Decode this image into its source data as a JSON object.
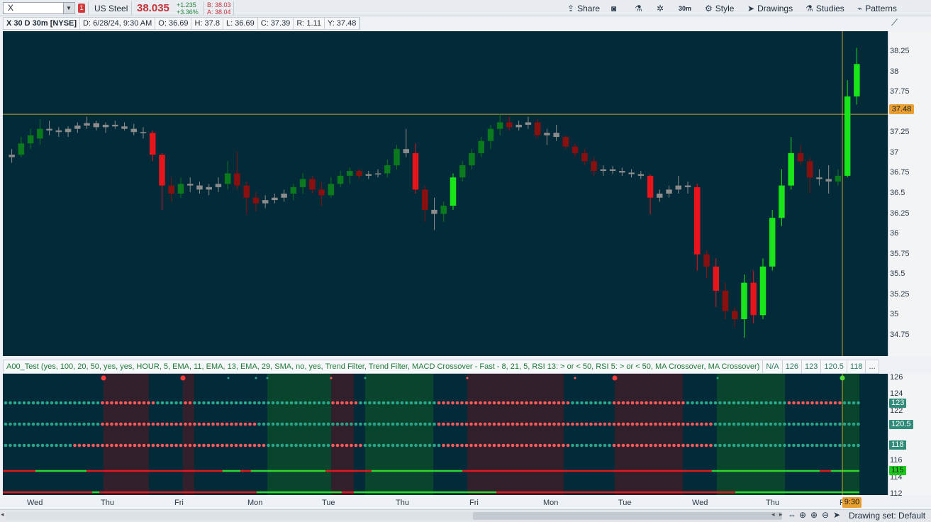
{
  "toolbar": {
    "symbol": "X",
    "alert_count": "1",
    "company": "US Steel",
    "last": "38.035",
    "net_change": "+1.235",
    "pct_change": "+3.36%",
    "bid": "B: 38.03",
    "ask": "A: 38.04",
    "share": "Share",
    "aggregation": "30m",
    "style": "Style",
    "drawings": "Drawings",
    "studies": "Studies",
    "patterns": "Patterns"
  },
  "infobar": {
    "desc": "X 30 D 30m [NYSE]",
    "date": "D: 6/28/24, 9:30 AM",
    "open": "O: 36.69",
    "high": "H: 37.8",
    "low": "L: 36.69",
    "close": "C: 37.39",
    "range": "R: 1.11",
    "y": "Y: 37.48"
  },
  "price_axis": {
    "ticks": [
      "38.25",
      "38",
      "37.75",
      "37.5",
      "37.25",
      "37",
      "36.75",
      "36.5",
      "36.25",
      "36",
      "35.75",
      "35.5",
      "35.25",
      "35",
      "34.75"
    ],
    "cursor_price": "37.48"
  },
  "study": {
    "title": "A00_Test (yes, 100, 20, 50, yes, yes, HOUR, 5, EMA, 11, EMA, 13, EMA, 29, SMA, no, yes, Trend Filter, Trend Filter, MACD Crossover - Fast - 8, 21, 5, RSI 13: > or < 50, RSI 5: > or < 50, MA Crossover, MA Crossover)",
    "values": [
      "N/A",
      "126",
      "123",
      "120.5",
      "118"
    ],
    "more": "...",
    "axis_ticks": [
      "126",
      "124",
      "122",
      "120",
      "118",
      "116",
      "114",
      "112"
    ],
    "level_tags": [
      "123",
      "120.5",
      "118",
      "115"
    ]
  },
  "time_axis": {
    "days": [
      "Wed",
      "Thu",
      "Fri",
      "Mon",
      "Tue",
      "Thu",
      "Fri",
      "Mon",
      "Tue",
      "Wed",
      "Thu",
      "F"
    ],
    "cursor_time": "9:30"
  },
  "bottombar": {
    "drawing_set": "Drawing set: Default"
  },
  "colors": {
    "chart_bg": "#032a38",
    "up_strong": "#19e619",
    "up_weak": "#0b7a1c",
    "down_strong": "#e8141c",
    "down_weak": "#8a1010",
    "neutral": "#8c8c8c",
    "crosshair": "#c8a02a",
    "dot_red": "#ff5a5a",
    "dot_teal": "#2aa58a"
  },
  "chart_data": {
    "type": "candlestick",
    "ylim": [
      34.6,
      38.4
    ],
    "ohlc": [
      [
        36.95,
        37.05,
        36.88,
        36.98
      ],
      [
        36.98,
        37.2,
        36.95,
        37.12
      ],
      [
        37.12,
        37.3,
        37.05,
        37.22
      ],
      [
        37.18,
        37.42,
        37.1,
        37.3
      ],
      [
        37.3,
        37.4,
        37.22,
        37.28
      ],
      [
        37.28,
        37.32,
        37.2,
        37.26
      ],
      [
        37.26,
        37.33,
        37.2,
        37.3
      ],
      [
        37.3,
        37.38,
        37.25,
        37.34
      ],
      [
        37.34,
        37.45,
        37.3,
        37.37
      ],
      [
        37.37,
        37.4,
        37.28,
        37.32
      ],
      [
        37.32,
        37.38,
        37.25,
        37.35
      ],
      [
        37.35,
        37.4,
        37.3,
        37.33
      ],
      [
        37.33,
        37.38,
        37.28,
        37.3
      ],
      [
        37.3,
        37.36,
        37.22,
        37.26
      ],
      [
        37.26,
        37.32,
        37.18,
        37.25
      ],
      [
        37.25,
        37.28,
        36.9,
        36.98
      ],
      [
        36.98,
        37.0,
        36.3,
        36.6
      ],
      [
        36.6,
        36.7,
        36.4,
        36.5
      ],
      [
        36.5,
        36.7,
        36.45,
        36.62
      ],
      [
        36.62,
        36.7,
        36.52,
        36.6
      ],
      [
        36.6,
        36.65,
        36.5,
        36.55
      ],
      [
        36.55,
        36.62,
        36.48,
        36.58
      ],
      [
        36.58,
        36.7,
        36.52,
        36.62
      ],
      [
        36.62,
        36.9,
        36.55,
        36.75
      ],
      [
        36.75,
        37.02,
        36.55,
        36.6
      ],
      [
        36.6,
        36.65,
        36.25,
        36.45
      ],
      [
        36.45,
        36.52,
        36.28,
        36.38
      ],
      [
        36.38,
        36.48,
        36.32,
        36.42
      ],
      [
        36.42,
        36.5,
        36.38,
        36.45
      ],
      [
        36.45,
        36.55,
        36.4,
        36.5
      ],
      [
        36.5,
        36.62,
        36.42,
        36.58
      ],
      [
        36.58,
        36.75,
        36.5,
        36.68
      ],
      [
        36.68,
        36.72,
        36.5,
        36.55
      ],
      [
        36.55,
        36.65,
        36.35,
        36.48
      ],
      [
        36.48,
        36.7,
        36.45,
        36.62
      ],
      [
        36.62,
        36.78,
        36.58,
        36.72
      ],
      [
        36.72,
        36.82,
        36.62,
        36.78
      ],
      [
        36.78,
        36.8,
        36.68,
        36.72
      ],
      [
        36.72,
        36.78,
        36.68,
        36.74
      ],
      [
        36.74,
        36.8,
        36.7,
        36.75
      ],
      [
        36.75,
        36.92,
        36.7,
        36.85
      ],
      [
        36.85,
        37.1,
        36.8,
        37.05
      ],
      [
        37.05,
        37.3,
        36.95,
        37.0
      ],
      [
        37.0,
        37.12,
        36.5,
        36.55
      ],
      [
        36.55,
        36.6,
        36.15,
        36.3
      ],
      [
        36.3,
        36.45,
        36.05,
        36.25
      ],
      [
        36.25,
        36.4,
        36.15,
        36.35
      ],
      [
        36.35,
        36.75,
        36.3,
        36.7
      ],
      [
        36.7,
        36.9,
        36.65,
        36.85
      ],
      [
        36.85,
        37.05,
        36.8,
        37.0
      ],
      [
        37.0,
        37.2,
        36.95,
        37.15
      ],
      [
        37.15,
        37.35,
        37.05,
        37.3
      ],
      [
        37.3,
        37.48,
        37.22,
        37.38
      ],
      [
        37.38,
        37.45,
        37.28,
        37.32
      ],
      [
        37.32,
        37.4,
        37.28,
        37.35
      ],
      [
        37.35,
        37.45,
        37.3,
        37.38
      ],
      [
        37.38,
        37.42,
        37.18,
        37.22
      ],
      [
        37.22,
        37.3,
        37.1,
        37.25
      ],
      [
        37.25,
        37.35,
        37.15,
        37.2
      ],
      [
        37.2,
        37.22,
        37.05,
        37.08
      ],
      [
        37.08,
        37.12,
        36.95,
        37.0
      ],
      [
        37.0,
        37.05,
        36.85,
        36.9
      ],
      [
        36.9,
        36.95,
        36.72,
        36.78
      ],
      [
        36.78,
        36.85,
        36.72,
        36.8
      ],
      [
        36.8,
        36.84,
        36.74,
        36.78
      ],
      [
        36.78,
        36.82,
        36.72,
        36.76
      ],
      [
        36.76,
        36.8,
        36.7,
        36.74
      ],
      [
        36.74,
        36.78,
        36.68,
        36.72
      ],
      [
        36.72,
        36.74,
        36.25,
        36.45
      ],
      [
        36.45,
        36.55,
        36.4,
        36.5
      ],
      [
        36.5,
        36.6,
        36.45,
        36.55
      ],
      [
        36.55,
        36.72,
        36.5,
        36.6
      ],
      [
        36.6,
        36.65,
        36.5,
        36.58
      ],
      [
        36.58,
        36.62,
        35.55,
        35.75
      ],
      [
        35.75,
        35.8,
        35.45,
        35.6
      ],
      [
        35.6,
        35.7,
        35.1,
        35.3
      ],
      [
        35.3,
        35.4,
        34.95,
        35.05
      ],
      [
        35.05,
        35.1,
        34.85,
        34.95
      ],
      [
        34.95,
        35.5,
        34.72,
        35.4
      ],
      [
        35.4,
        35.55,
        34.9,
        35.0
      ],
      [
        35.0,
        35.7,
        34.95,
        35.6
      ],
      [
        35.6,
        36.3,
        35.55,
        36.2
      ],
      [
        36.2,
        36.8,
        36.1,
        36.6
      ],
      [
        36.6,
        37.2,
        36.55,
        37.0
      ],
      [
        37.0,
        37.1,
        36.85,
        36.9
      ],
      [
        36.9,
        36.95,
        36.5,
        36.7
      ],
      [
        36.7,
        36.8,
        36.6,
        36.68
      ],
      [
        36.68,
        36.85,
        36.5,
        36.65
      ],
      [
        36.65,
        36.8,
        36.6,
        36.72
      ],
      [
        36.72,
        37.9,
        36.7,
        37.7
      ],
      [
        37.7,
        38.3,
        37.6,
        38.1
      ]
    ]
  }
}
